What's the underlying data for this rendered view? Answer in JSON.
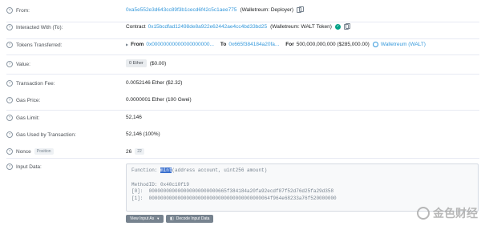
{
  "rows": {
    "from": {
      "label": "From:",
      "address": "0xa5e552e3d643cc89f3b1cecd6f42c5c1aee775",
      "tag": "(Walletreum: Deployer)",
      "icons": [
        "help-icon",
        "copy-icon"
      ]
    },
    "interacted": {
      "label": "Interacted With (To):",
      "prefix": "Contract",
      "address": "0x15bcdfad12498de8a922e62442ae4cc4bd33bd25",
      "tag": "(Walletreum: WALT Token)",
      "icons": [
        "help-icon",
        "verified-check-icon",
        "copy-icon"
      ]
    },
    "tokens": {
      "label": "Tokens Transferred:",
      "from_label": "From",
      "from_address": "0x00000000000000000000...",
      "to_label": "To",
      "to_address": "0x665f384184a20fa...",
      "for_label": "For",
      "amount": "500,000,000,000 ($285,000.00)",
      "token_name": "Walletreum (WALT)",
      "icons": [
        "help-icon",
        "triangle-icon",
        "token-logo-icon"
      ]
    },
    "value": {
      "label": "Value:",
      "badge": "0 Ether",
      "usd": "($0.00)"
    },
    "fee": {
      "label": "Transaction Fee:",
      "value": "0.0052146 Ether ($2.32)"
    },
    "gas_price": {
      "label": "Gas Price:",
      "value": "0.0000001 Ether (100 Gwei)"
    },
    "gas_limit": {
      "label": "Gas Limit:",
      "value": "52,146"
    },
    "gas_used": {
      "label": "Gas Used by Transaction:",
      "value": "52,146 (100%)"
    },
    "nonce": {
      "label": "Nonce",
      "badge": "Position",
      "value": "26",
      "position": "22"
    },
    "input": {
      "label": "Input Data:",
      "function_prefix": "Function: ",
      "function_name": "mint",
      "function_args": "(address account, uint256 amount)",
      "method_id": "MethodID: 0x40c10f19",
      "param0": "[0]:  000000000000000000000000665f384184a20fa92ecdf87f52d76d25fa29d358",
      "param1": "[1]:  000000000000000000000000000000000000000064f964e68233a76f520000000"
    }
  },
  "buttons": {
    "view_input": "View Input As",
    "decode": "Decode Input Data"
  },
  "watermark": {
    "text": "金色财经"
  },
  "colors": {
    "link": "#3498db",
    "check": "#00a186",
    "highlight": "#3d72cf"
  }
}
